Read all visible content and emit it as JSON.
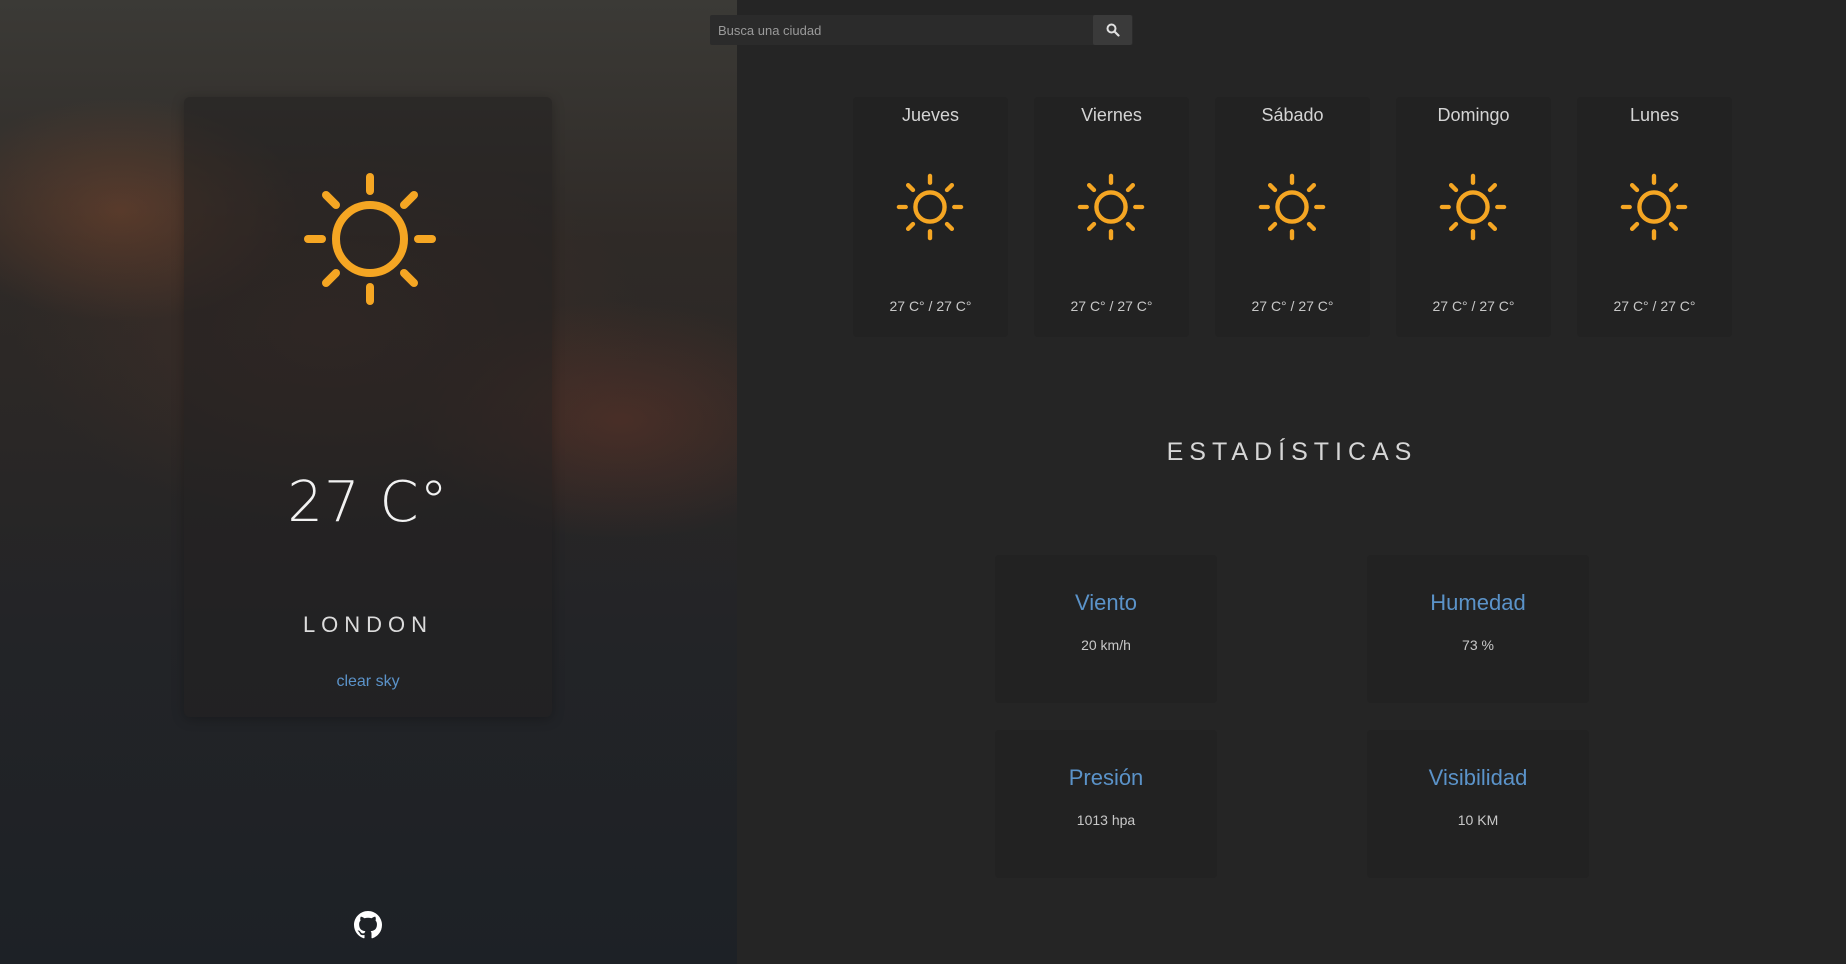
{
  "search": {
    "placeholder": "Busca una ciudad",
    "button_icon": "search-icon"
  },
  "current": {
    "icon": "sun-icon",
    "temperature": "27 C°",
    "city": "LONDON",
    "condition": "clear sky"
  },
  "forecast": [
    {
      "day": "Jueves",
      "icon": "sun-icon",
      "temp": "27 C° / 27 C°"
    },
    {
      "day": "Viernes",
      "icon": "sun-icon",
      "temp": "27 C° / 27 C°"
    },
    {
      "day": "Sábado",
      "icon": "sun-icon",
      "temp": "27 C° / 27 C°"
    },
    {
      "day": "Domingo",
      "icon": "sun-icon",
      "temp": "27 C° / 27 C°"
    },
    {
      "day": "Lunes",
      "icon": "sun-icon",
      "temp": "27 C° / 27 C°"
    }
  ],
  "stats": {
    "title": "ESTADÍSTICAS",
    "items": [
      {
        "label": "Viento",
        "value": "20 km/h"
      },
      {
        "label": "Humedad",
        "value": "73 %"
      },
      {
        "label": "Presión",
        "value": "1013 hpa"
      },
      {
        "label": "Visibilidad",
        "value": "10 KM"
      }
    ]
  },
  "footer": {
    "icon": "github-icon"
  },
  "colors": {
    "accent": "#5b93c9",
    "sun": "#f5a623",
    "panel": "#222222",
    "background": "#252525"
  }
}
